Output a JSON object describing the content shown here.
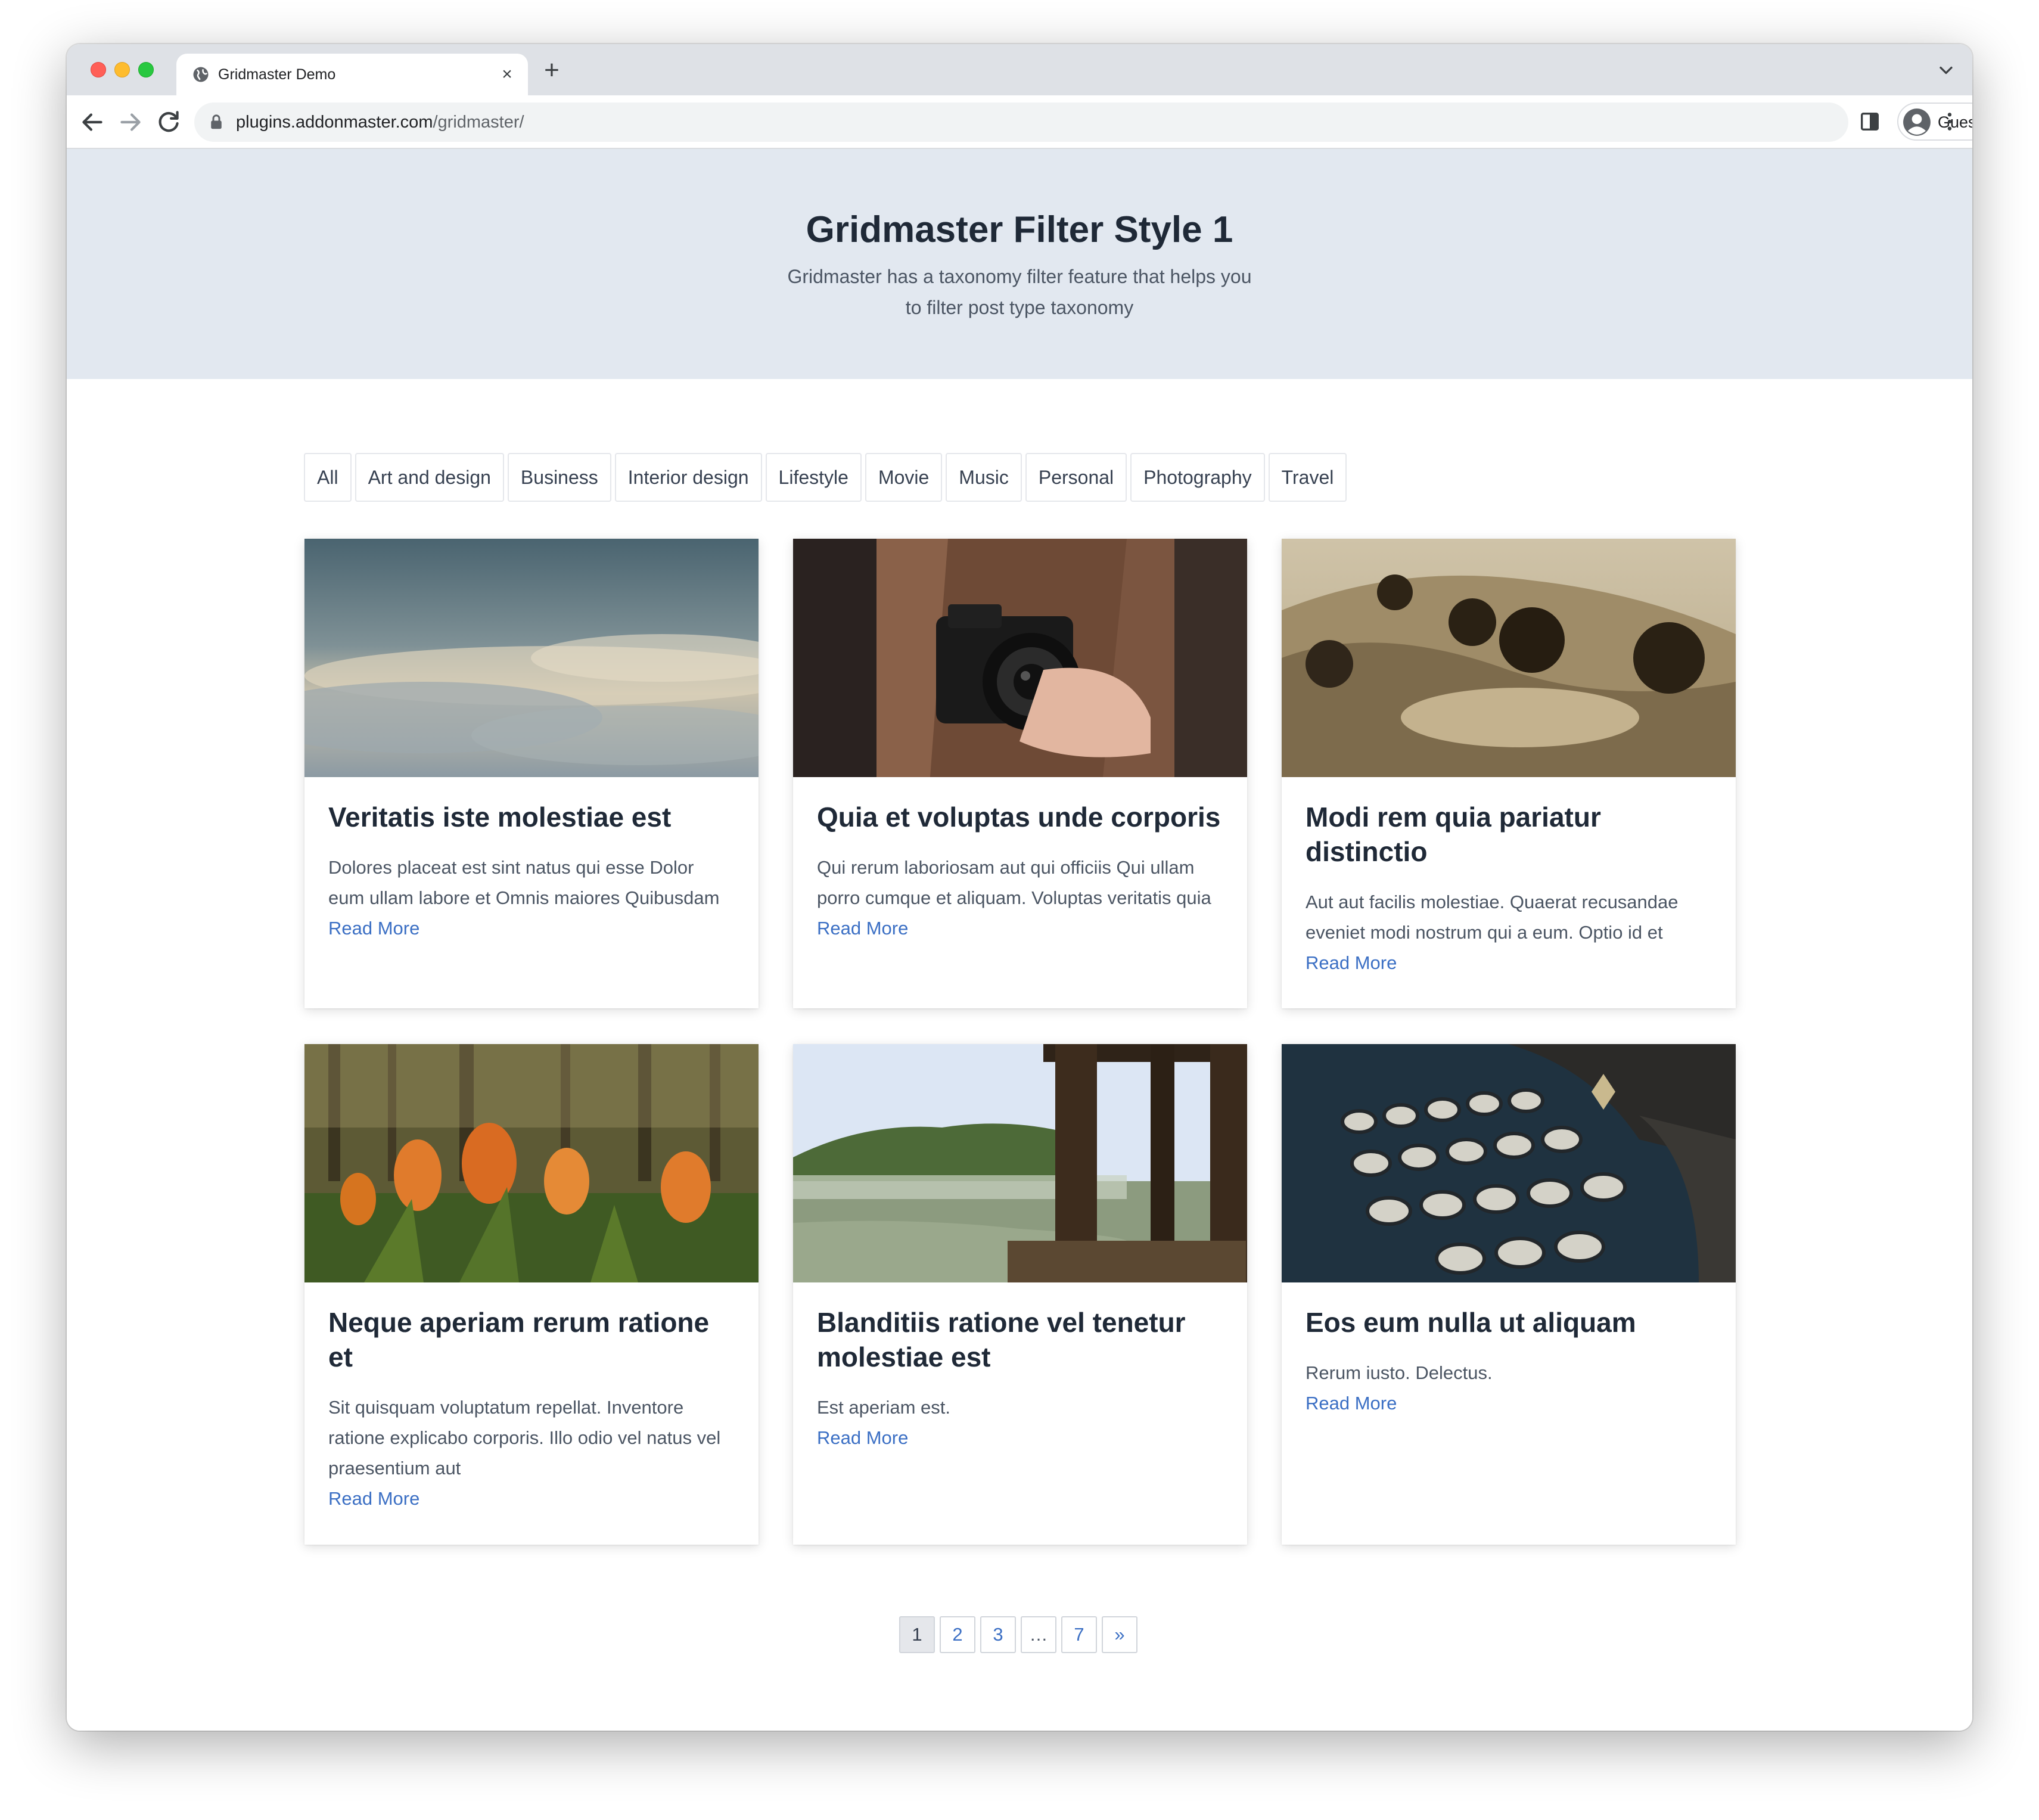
{
  "browser": {
    "tab_title": "Gridmaster Demo",
    "tab_close": "×",
    "new_tab": "+",
    "url_host": "plugins.addonmaster.com",
    "url_path": "/gridmaster/",
    "profile_label": "Guest"
  },
  "hero": {
    "title": "Gridmaster Filter Style 1",
    "subtitle": "Gridmaster has a taxonomy filter feature that helps you to filter post type taxonomy"
  },
  "filters": [
    "All",
    "Art and design",
    "Business",
    "Interior design",
    "Lifestyle",
    "Movie",
    "Music",
    "Personal",
    "Photography",
    "Travel"
  ],
  "posts": [
    {
      "title": "Veritatis iste molestiae est",
      "excerpt": "Dolores placeat est sint natus qui esse Dolor eum ullam labore et Omnis maiores Quibusdam",
      "link": "Read More",
      "image": "cloudy-sky-photo"
    },
    {
      "title": "Quia et voluptas unde corporis",
      "excerpt": "Qui rerum laboriosam aut qui officiis Qui ullam porro cumque et aliquam. Voluptas veritatis quia",
      "link": "Read More",
      "image": "camera-in-hands-photo"
    },
    {
      "title": "Modi rem quia pariatur distinctio",
      "excerpt": "Aut aut facilis molestiae. Quaerat recusandae eveniet modi nostrum qui a eum. Optio id et",
      "link": "Read More",
      "image": "hills-with-trees-photo"
    },
    {
      "title": "Neque aperiam rerum ratione et",
      "excerpt": "Sit quisquam voluptatum repellat. Inventore ratione explicabo corporis. Illo odio vel natus vel praesentium aut",
      "link": "Read More",
      "image": "tulips-in-forest-photo"
    },
    {
      "title": "Blanditiis ratione vel tenetur molestiae est",
      "excerpt": "Est aperiam est.",
      "link": "Read More",
      "image": "misty-lake-dock-photo"
    },
    {
      "title": "Eos eum nulla ut aliquam",
      "excerpt": "Rerum iusto. Delectus.",
      "link": "Read More",
      "image": "vintage-typewriter-photo"
    }
  ],
  "pagination": {
    "pages": [
      "1",
      "2",
      "3",
      "…",
      "7",
      "»"
    ],
    "current": "1"
  },
  "colors": {
    "hero_bg": "#e2e8f0",
    "link": "#3b6fc4",
    "title": "#1f2937"
  }
}
